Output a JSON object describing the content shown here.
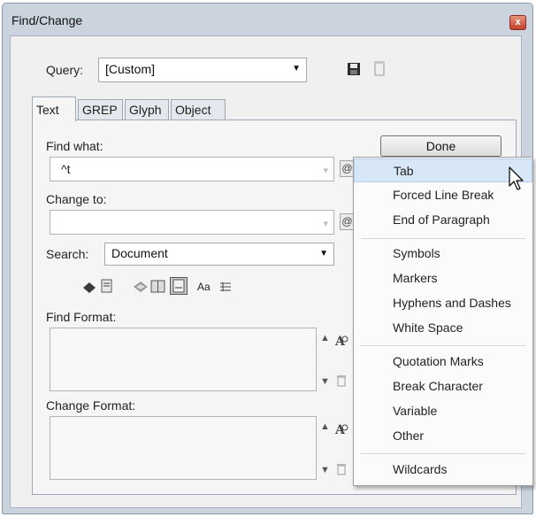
{
  "window": {
    "title": "Find/Change",
    "close_glyph": "x"
  },
  "query": {
    "label": "Query:",
    "value": "[Custom]"
  },
  "tabs": [
    {
      "label": "Text"
    },
    {
      "label": "GREP"
    },
    {
      "label": "Glyph"
    },
    {
      "label": "Object"
    }
  ],
  "active_tab": "Text",
  "find": {
    "label": "Find what:",
    "value": "^t"
  },
  "change": {
    "label": "Change to:",
    "value": ""
  },
  "done_label": "Done",
  "search": {
    "label": "Search:",
    "value": "Document"
  },
  "options_toolbar": {
    "case_label": "Aa"
  },
  "find_format": {
    "label": "Find Format:"
  },
  "change_format": {
    "label": "Change Format:"
  },
  "special_chars_menu": {
    "items": [
      {
        "label": "Tab",
        "highlighted": true
      },
      {
        "label": "Forced Line Break"
      },
      {
        "label": "End of Paragraph"
      },
      {
        "label": "Symbols"
      },
      {
        "label": "Markers"
      },
      {
        "label": "Hyphens and Dashes"
      },
      {
        "label": "White Space"
      },
      {
        "label": "Quotation Marks"
      },
      {
        "label": "Break Character"
      },
      {
        "label": "Variable"
      },
      {
        "label": "Other"
      },
      {
        "label": "Wildcards"
      }
    ]
  },
  "colors": {
    "highlight": "#d7e7f7",
    "window_frame": "#cbd3de",
    "close_button": "#c4412b"
  }
}
